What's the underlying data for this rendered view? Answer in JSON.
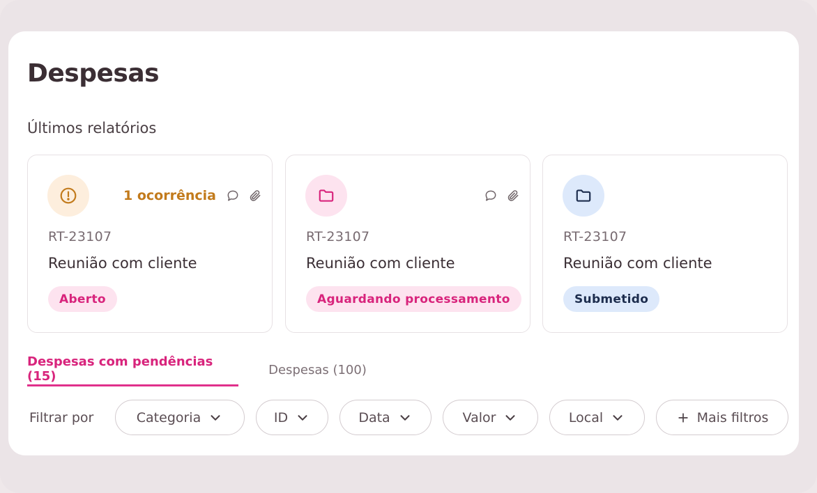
{
  "page": {
    "title": "Despesas"
  },
  "section": {
    "title": "Últimos relatórios"
  },
  "cards": [
    {
      "icon": "alert-circle-icon",
      "occurrence": "1 ocorrência",
      "id": "RT-23107",
      "name": "Reunião com cliente",
      "status": "Aberto",
      "status_color": "#d8247c"
    },
    {
      "icon": "folder-icon",
      "id": "RT-23107",
      "name": "Reunião com cliente",
      "status": "Aguardando processamento",
      "status_color": "#d8247c"
    },
    {
      "icon": "folder-icon",
      "id": "RT-23107",
      "name": "Reunião com cliente",
      "status": "Submetido",
      "status_color": "#1d2d4e"
    }
  ],
  "tabs": [
    {
      "label": "Despesas com pendências (15)",
      "active": true
    },
    {
      "label": "Despesas (100)",
      "active": false
    }
  ],
  "filters": {
    "label": "Filtrar por",
    "chips": [
      "Categoria",
      "ID",
      "Data",
      "Valor",
      "Local"
    ],
    "more": "Mais filtros"
  },
  "colors": {
    "accent": "#d8247c",
    "warning": "#c27a1b",
    "navy": "#1d2d4e"
  }
}
